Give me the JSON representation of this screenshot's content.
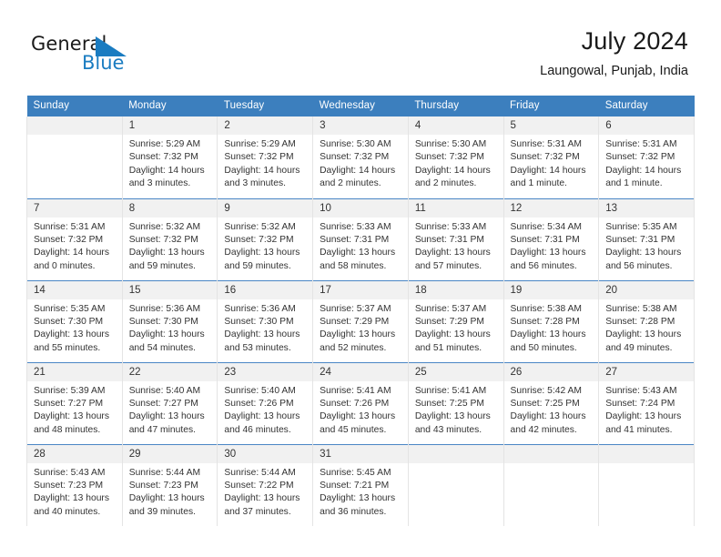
{
  "brand": {
    "name_part1": "General",
    "name_part2": "Blue",
    "logo_icon": "blue-triangle-flag",
    "color_dark": "#1a1a1a",
    "color_blue": "#1a7cc1"
  },
  "header": {
    "title": "July 2024",
    "subtitle": "Laungowal, Punjab, India"
  },
  "theme": {
    "header_blue": "#3c7fbe",
    "row_separator_blue": "#4a86c5",
    "daynum_bg": "#f1f1f1",
    "text": "#333333"
  },
  "calendar": {
    "weekday_headers": [
      "Sunday",
      "Monday",
      "Tuesday",
      "Wednesday",
      "Thursday",
      "Friday",
      "Saturday"
    ],
    "weeks": [
      [
        {
          "day": "",
          "sunrise": "",
          "sunset": "",
          "daylight1": "",
          "daylight2": ""
        },
        {
          "day": "1",
          "sunrise": "Sunrise: 5:29 AM",
          "sunset": "Sunset: 7:32 PM",
          "daylight1": "Daylight: 14 hours",
          "daylight2": "and 3 minutes."
        },
        {
          "day": "2",
          "sunrise": "Sunrise: 5:29 AM",
          "sunset": "Sunset: 7:32 PM",
          "daylight1": "Daylight: 14 hours",
          "daylight2": "and 3 minutes."
        },
        {
          "day": "3",
          "sunrise": "Sunrise: 5:30 AM",
          "sunset": "Sunset: 7:32 PM",
          "daylight1": "Daylight: 14 hours",
          "daylight2": "and 2 minutes."
        },
        {
          "day": "4",
          "sunrise": "Sunrise: 5:30 AM",
          "sunset": "Sunset: 7:32 PM",
          "daylight1": "Daylight: 14 hours",
          "daylight2": "and 2 minutes."
        },
        {
          "day": "5",
          "sunrise": "Sunrise: 5:31 AM",
          "sunset": "Sunset: 7:32 PM",
          "daylight1": "Daylight: 14 hours",
          "daylight2": "and 1 minute."
        },
        {
          "day": "6",
          "sunrise": "Sunrise: 5:31 AM",
          "sunset": "Sunset: 7:32 PM",
          "daylight1": "Daylight: 14 hours",
          "daylight2": "and 1 minute."
        }
      ],
      [
        {
          "day": "7",
          "sunrise": "Sunrise: 5:31 AM",
          "sunset": "Sunset: 7:32 PM",
          "daylight1": "Daylight: 14 hours",
          "daylight2": "and 0 minutes."
        },
        {
          "day": "8",
          "sunrise": "Sunrise: 5:32 AM",
          "sunset": "Sunset: 7:32 PM",
          "daylight1": "Daylight: 13 hours",
          "daylight2": "and 59 minutes."
        },
        {
          "day": "9",
          "sunrise": "Sunrise: 5:32 AM",
          "sunset": "Sunset: 7:32 PM",
          "daylight1": "Daylight: 13 hours",
          "daylight2": "and 59 minutes."
        },
        {
          "day": "10",
          "sunrise": "Sunrise: 5:33 AM",
          "sunset": "Sunset: 7:31 PM",
          "daylight1": "Daylight: 13 hours",
          "daylight2": "and 58 minutes."
        },
        {
          "day": "11",
          "sunrise": "Sunrise: 5:33 AM",
          "sunset": "Sunset: 7:31 PM",
          "daylight1": "Daylight: 13 hours",
          "daylight2": "and 57 minutes."
        },
        {
          "day": "12",
          "sunrise": "Sunrise: 5:34 AM",
          "sunset": "Sunset: 7:31 PM",
          "daylight1": "Daylight: 13 hours",
          "daylight2": "and 56 minutes."
        },
        {
          "day": "13",
          "sunrise": "Sunrise: 5:35 AM",
          "sunset": "Sunset: 7:31 PM",
          "daylight1": "Daylight: 13 hours",
          "daylight2": "and 56 minutes."
        }
      ],
      [
        {
          "day": "14",
          "sunrise": "Sunrise: 5:35 AM",
          "sunset": "Sunset: 7:30 PM",
          "daylight1": "Daylight: 13 hours",
          "daylight2": "and 55 minutes."
        },
        {
          "day": "15",
          "sunrise": "Sunrise: 5:36 AM",
          "sunset": "Sunset: 7:30 PM",
          "daylight1": "Daylight: 13 hours",
          "daylight2": "and 54 minutes."
        },
        {
          "day": "16",
          "sunrise": "Sunrise: 5:36 AM",
          "sunset": "Sunset: 7:30 PM",
          "daylight1": "Daylight: 13 hours",
          "daylight2": "and 53 minutes."
        },
        {
          "day": "17",
          "sunrise": "Sunrise: 5:37 AM",
          "sunset": "Sunset: 7:29 PM",
          "daylight1": "Daylight: 13 hours",
          "daylight2": "and 52 minutes."
        },
        {
          "day": "18",
          "sunrise": "Sunrise: 5:37 AM",
          "sunset": "Sunset: 7:29 PM",
          "daylight1": "Daylight: 13 hours",
          "daylight2": "and 51 minutes."
        },
        {
          "day": "19",
          "sunrise": "Sunrise: 5:38 AM",
          "sunset": "Sunset: 7:28 PM",
          "daylight1": "Daylight: 13 hours",
          "daylight2": "and 50 minutes."
        },
        {
          "day": "20",
          "sunrise": "Sunrise: 5:38 AM",
          "sunset": "Sunset: 7:28 PM",
          "daylight1": "Daylight: 13 hours",
          "daylight2": "and 49 minutes."
        }
      ],
      [
        {
          "day": "21",
          "sunrise": "Sunrise: 5:39 AM",
          "sunset": "Sunset: 7:27 PM",
          "daylight1": "Daylight: 13 hours",
          "daylight2": "and 48 minutes."
        },
        {
          "day": "22",
          "sunrise": "Sunrise: 5:40 AM",
          "sunset": "Sunset: 7:27 PM",
          "daylight1": "Daylight: 13 hours",
          "daylight2": "and 47 minutes."
        },
        {
          "day": "23",
          "sunrise": "Sunrise: 5:40 AM",
          "sunset": "Sunset: 7:26 PM",
          "daylight1": "Daylight: 13 hours",
          "daylight2": "and 46 minutes."
        },
        {
          "day": "24",
          "sunrise": "Sunrise: 5:41 AM",
          "sunset": "Sunset: 7:26 PM",
          "daylight1": "Daylight: 13 hours",
          "daylight2": "and 45 minutes."
        },
        {
          "day": "25",
          "sunrise": "Sunrise: 5:41 AM",
          "sunset": "Sunset: 7:25 PM",
          "daylight1": "Daylight: 13 hours",
          "daylight2": "and 43 minutes."
        },
        {
          "day": "26",
          "sunrise": "Sunrise: 5:42 AM",
          "sunset": "Sunset: 7:25 PM",
          "daylight1": "Daylight: 13 hours",
          "daylight2": "and 42 minutes."
        },
        {
          "day": "27",
          "sunrise": "Sunrise: 5:43 AM",
          "sunset": "Sunset: 7:24 PM",
          "daylight1": "Daylight: 13 hours",
          "daylight2": "and 41 minutes."
        }
      ],
      [
        {
          "day": "28",
          "sunrise": "Sunrise: 5:43 AM",
          "sunset": "Sunset: 7:23 PM",
          "daylight1": "Daylight: 13 hours",
          "daylight2": "and 40 minutes."
        },
        {
          "day": "29",
          "sunrise": "Sunrise: 5:44 AM",
          "sunset": "Sunset: 7:23 PM",
          "daylight1": "Daylight: 13 hours",
          "daylight2": "and 39 minutes."
        },
        {
          "day": "30",
          "sunrise": "Sunrise: 5:44 AM",
          "sunset": "Sunset: 7:22 PM",
          "daylight1": "Daylight: 13 hours",
          "daylight2": "and 37 minutes."
        },
        {
          "day": "31",
          "sunrise": "Sunrise: 5:45 AM",
          "sunset": "Sunset: 7:21 PM",
          "daylight1": "Daylight: 13 hours",
          "daylight2": "and 36 minutes."
        },
        {
          "day": "",
          "sunrise": "",
          "sunset": "",
          "daylight1": "",
          "daylight2": ""
        },
        {
          "day": "",
          "sunrise": "",
          "sunset": "",
          "daylight1": "",
          "daylight2": ""
        },
        {
          "day": "",
          "sunrise": "",
          "sunset": "",
          "daylight1": "",
          "daylight2": ""
        }
      ]
    ]
  }
}
